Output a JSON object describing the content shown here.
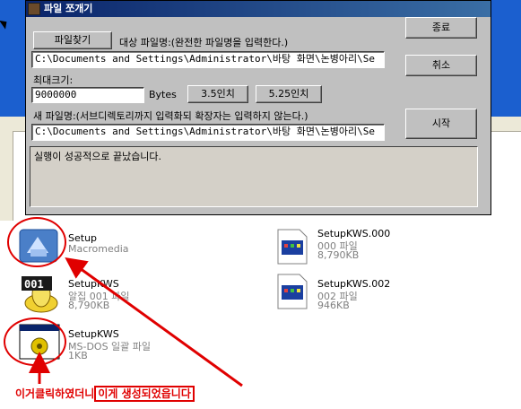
{
  "dialog": {
    "title": "파일 쪼개기",
    "find_file_button": "파일찾기",
    "target_label": "대상 파일명:(완전한 파일명을 입력한다.)",
    "target_path": "C:\\Documents and Settings\\Administrator\\바탕 화면\\논병아리\\Se",
    "max_size_label": "최대크기:",
    "max_size_value": "9000000",
    "bytes_label": "Bytes",
    "btn_35": "3.5인치",
    "btn_525": "5.25인치",
    "new_name_label": "새 파일명:(서브디렉토리까지 입력화되 확장자는 입력하지 않는다.)",
    "new_path": "C:\\Documents and Settings\\Administrator\\바탕 화면\\논병아리\\Se",
    "exit_button": "종료",
    "cancel_button": "취소",
    "start_button": "시작",
    "log_text": "실행이 성공적으로 끝났습니다."
  },
  "files": [
    {
      "name": "Setup",
      "type": "Macromedia",
      "size": "",
      "icon": "macromedia-setup-icon"
    },
    {
      "name": "SetupKWS",
      "type": "알집 001 파일",
      "size": "8,790KB",
      "icon": "alzip-001-icon"
    },
    {
      "name": "SetupKWS",
      "type": "MS-DOS 일괄 파일",
      "size": "1KB",
      "icon": "batch-file-icon"
    },
    {
      "name": "SetupKWS.000",
      "type": "000 파일",
      "size": "8,790KB",
      "icon": "generic-file-icon"
    },
    {
      "name": "SetupKWS.002",
      "type": "002 파일",
      "size": "946KB",
      "icon": "generic-file-icon"
    }
  ],
  "annotation": {
    "part1": "이거클릭하였더니",
    "part2": "이게 생성되었읍니다"
  },
  "colors": {
    "annotation": "#e00000",
    "titlebar": "#0a246a"
  }
}
